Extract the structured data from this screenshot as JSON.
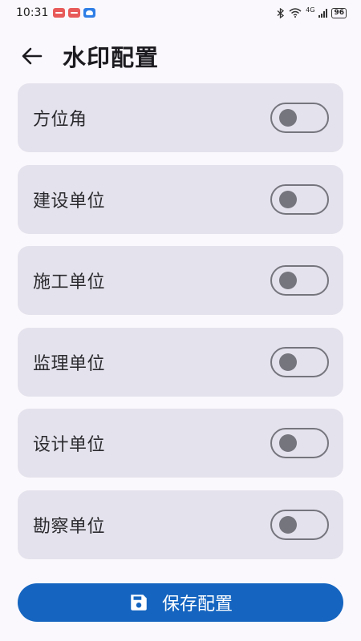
{
  "status_bar": {
    "time": "10:31",
    "network": "4G",
    "battery": "96"
  },
  "header": {
    "title": "水印配置",
    "back_icon": "arrow-left-icon"
  },
  "settings": [
    {
      "label": "方位角",
      "enabled": false
    },
    {
      "label": "建设单位",
      "enabled": false
    },
    {
      "label": "施工单位",
      "enabled": false
    },
    {
      "label": "监理单位",
      "enabled": false
    },
    {
      "label": "设计单位",
      "enabled": false
    },
    {
      "label": "勘察单位",
      "enabled": false
    }
  ],
  "save_button": {
    "label": "保存配置",
    "icon": "save-icon"
  },
  "colors": {
    "primary": "#1565c0",
    "card_bg": "#e4e2ec",
    "toggle_off": "#75757e"
  }
}
